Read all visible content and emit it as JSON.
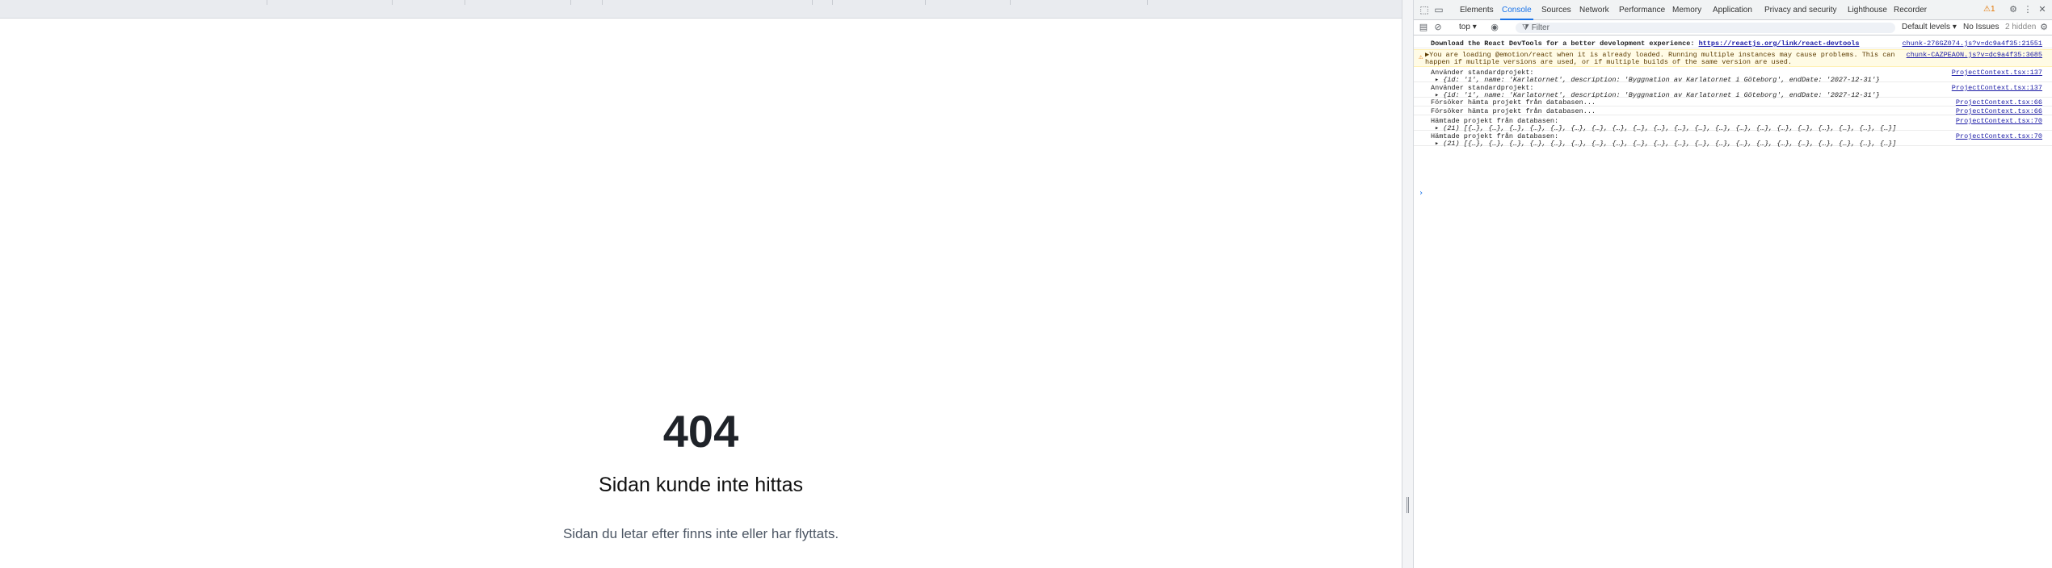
{
  "page": {
    "code": "404",
    "title": "Sidan kunde inte hittas",
    "text": "Sidan du letar efter finns inte eller har flyttats."
  },
  "devtools": {
    "tabs": [
      "Elements",
      "Console",
      "Sources",
      "Network",
      "Performance",
      "Memory",
      "Application",
      "Privacy and security",
      "Lighthouse",
      "Recorder"
    ],
    "active_tab": "Console",
    "warning_count": "1",
    "toolbar": {
      "context": "top",
      "filter_placeholder": "Filter",
      "levels": "Default levels",
      "issues": "No Issues",
      "hidden": "2 hidden"
    },
    "messages": [
      {
        "type": "info",
        "text": "Download the React DevTools for a better development experience: ",
        "link": "https://reactjs.org/link/react-devtools",
        "source": "chunk-276GZ074.js?v=dc9a4f35:21551"
      },
      {
        "type": "warning",
        "text": "▶You are loading @emotion/react when it is already loaded. Running multiple instances may cause problems. This can",
        "text2": "happen if multiple versions are used, or if multiple builds of the same version are used.",
        "source": "chunk-CAZPEAON.js?v=dc9a4f35:3685"
      },
      {
        "type": "log",
        "text": "Använder standardprojekt:",
        "sub": "▸ {id: '1', name: 'Karlatornet', description: 'Byggnation av Karlatornet i Göteborg', endDate: '2027-12-31'}",
        "source": "ProjectContext.tsx:137"
      },
      {
        "type": "log",
        "text": "Använder standardprojekt:",
        "sub": "▸ {id: '1', name: 'Karlatornet', description: 'Byggnation av Karlatornet i Göteborg', endDate: '2027-12-31'}",
        "source": "ProjectContext.tsx:137"
      },
      {
        "type": "log",
        "text": "Försöker hämta projekt från databasen...",
        "source": "ProjectContext.tsx:66"
      },
      {
        "type": "log",
        "text": "Försöker hämta projekt från databasen...",
        "source": "ProjectContext.tsx:66"
      },
      {
        "type": "log",
        "text": "Hämtade projekt från databasen:",
        "sub": "▸ (21) [{…}, {…}, {…}, {…}, {…}, {…}, {…}, {…}, {…}, {…}, {…}, {…}, {…}, {…}, {…}, {…}, {…}, {…}, {…}, {…}, {…}]",
        "source": "ProjectContext.tsx:70"
      },
      {
        "type": "log",
        "text": "Hämtade projekt från databasen:",
        "sub": "▸ (21) [{…}, {…}, {…}, {…}, {…}, {…}, {…}, {…}, {…}, {…}, {…}, {…}, {…}, {…}, {…}, {…}, {…}, {…}, {…}, {…}, {…}]",
        "source": "ProjectContext.tsx:70"
      }
    ],
    "prompt": "›"
  },
  "colors": {
    "accent": "#1a73e8",
    "warning": "#e37400",
    "link": "#1a1aa6"
  }
}
